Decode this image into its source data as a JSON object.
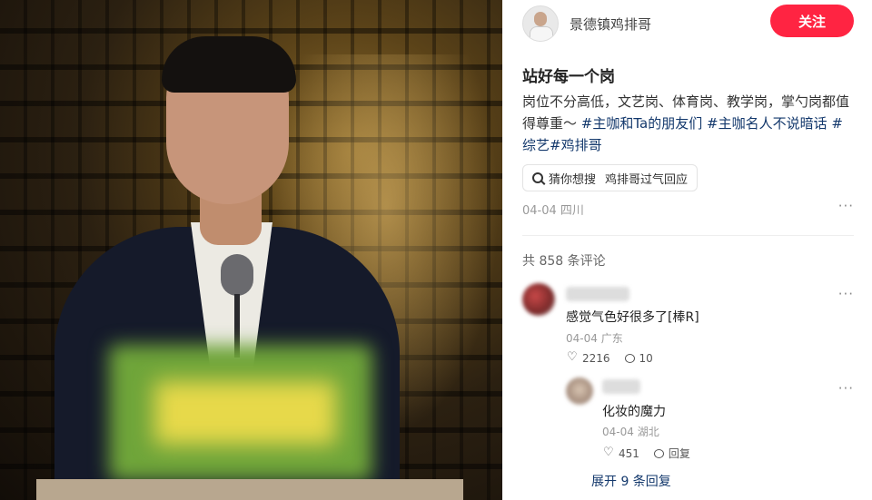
{
  "author": {
    "name": "景德镇鸡排哥",
    "follow_label": "关注"
  },
  "post": {
    "title": "站好每一个岗",
    "desc_text": "岗位不分高低，文艺岗、体育岗、教学岗，掌勺岗都值得尊重～ ",
    "tags": [
      "#主咖和Ta的朋友们",
      "#主咖名人不说暗话",
      "#综艺",
      "#鸡排哥"
    ],
    "search_label": "猜你想搜",
    "search_query": "鸡排哥过气回应",
    "date": "04-04",
    "location": "四川",
    "more": "···"
  },
  "comments": {
    "count_text": "共 858 条评论",
    "items": [
      {
        "text": "感觉气色好很多了[棒R]",
        "date": "04-04",
        "location": "广东",
        "likes": "2216",
        "replies": "10",
        "more": "···"
      }
    ],
    "reply": {
      "text": "化妆的魔力",
      "date": "04-04",
      "location": "湖北",
      "likes": "451",
      "reply_label": "回复",
      "more": "···"
    },
    "expand_label": "展开 9 条回复"
  }
}
